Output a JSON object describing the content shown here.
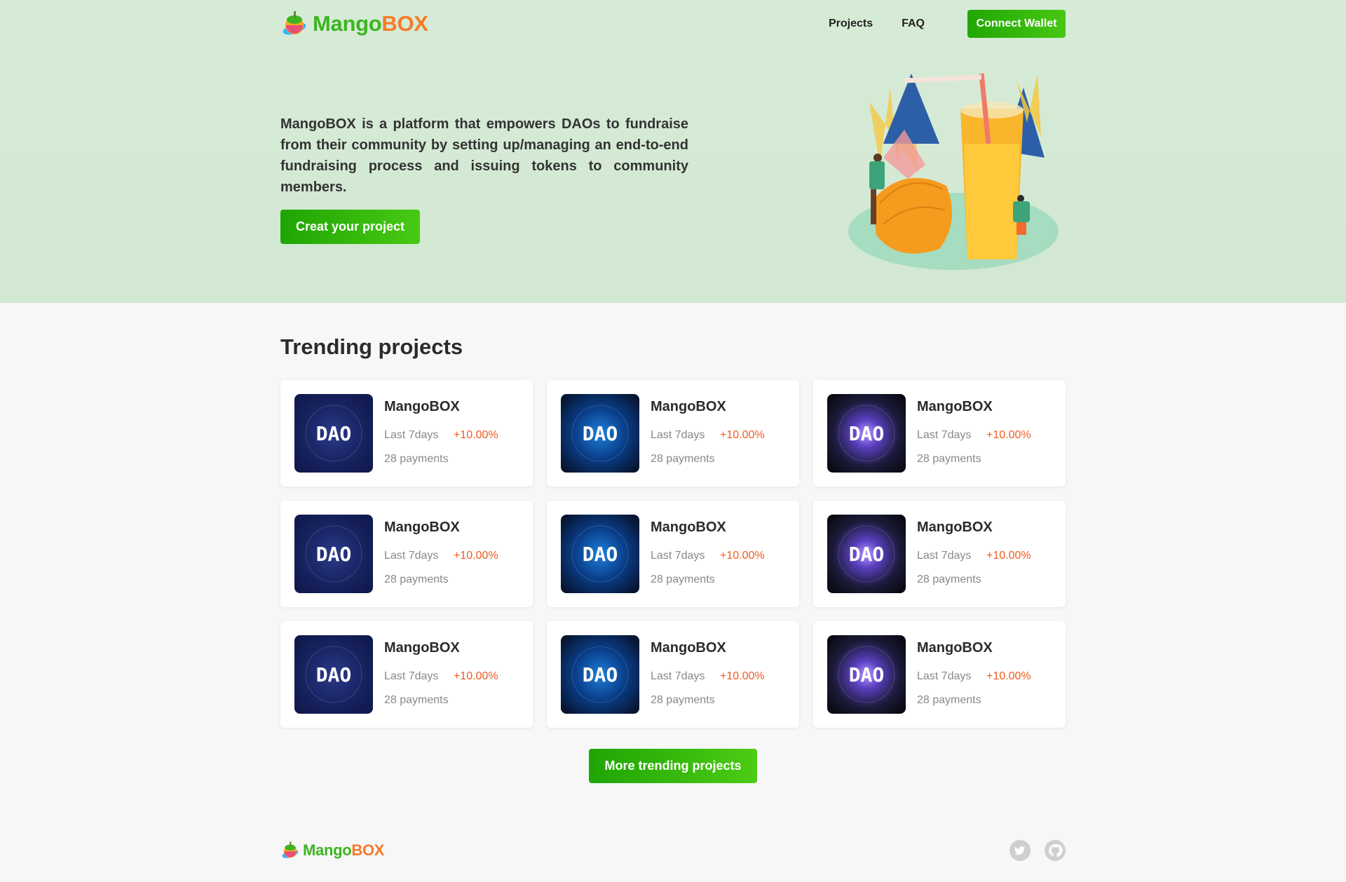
{
  "header": {
    "logo_part1": "Mango",
    "logo_part2": "BOX",
    "nav": [
      "Projects",
      "FAQ"
    ],
    "connect_wallet": "Connect Wallet"
  },
  "hero": {
    "description": "MangoBOX is a platform that empowers DAOs to fundraise from their community by setting up/managing an end-to-end fundraising process and issuing tokens to community members.",
    "create_button": "Creat your project"
  },
  "trending": {
    "title": "Trending projects",
    "cards": [
      {
        "name": "MangoBOX",
        "period": "Last 7days",
        "change": "+10.00%",
        "payments": "28 payments",
        "thumb": "DAO",
        "style": "v1"
      },
      {
        "name": "MangoBOX",
        "period": "Last 7days",
        "change": "+10.00%",
        "payments": "28 payments",
        "thumb": "DAO",
        "style": "v2"
      },
      {
        "name": "MangoBOX",
        "period": "Last 7days",
        "change": "+10.00%",
        "payments": "28 payments",
        "thumb": "DAO",
        "style": "v3"
      },
      {
        "name": "MangoBOX",
        "period": "Last 7days",
        "change": "+10.00%",
        "payments": "28 payments",
        "thumb": "DAO",
        "style": "v1"
      },
      {
        "name": "MangoBOX",
        "period": "Last 7days",
        "change": "+10.00%",
        "payments": "28 payments",
        "thumb": "DAO",
        "style": "v2"
      },
      {
        "name": "MangoBOX",
        "period": "Last 7days",
        "change": "+10.00%",
        "payments": "28 payments",
        "thumb": "DAO",
        "style": "v3"
      },
      {
        "name": "MangoBOX",
        "period": "Last 7days",
        "change": "+10.00%",
        "payments": "28 payments",
        "thumb": "DAO",
        "style": "v1"
      },
      {
        "name": "MangoBOX",
        "period": "Last 7days",
        "change": "+10.00%",
        "payments": "28 payments",
        "thumb": "DAO",
        "style": "v2"
      },
      {
        "name": "MangoBOX",
        "period": "Last 7days",
        "change": "+10.00%",
        "payments": "28 payments",
        "thumb": "DAO",
        "style": "v3"
      }
    ],
    "more_button": "More trending projects"
  },
  "footer": {
    "logo_part1": "Mango",
    "logo_part2": "BOX",
    "social": [
      "twitter-icon",
      "github-icon"
    ]
  },
  "colors": {
    "brand_green": "#3cb521",
    "brand_orange": "#f57b28",
    "change_positive": "#f25a1e",
    "hero_bg": "#d6ebd6"
  }
}
